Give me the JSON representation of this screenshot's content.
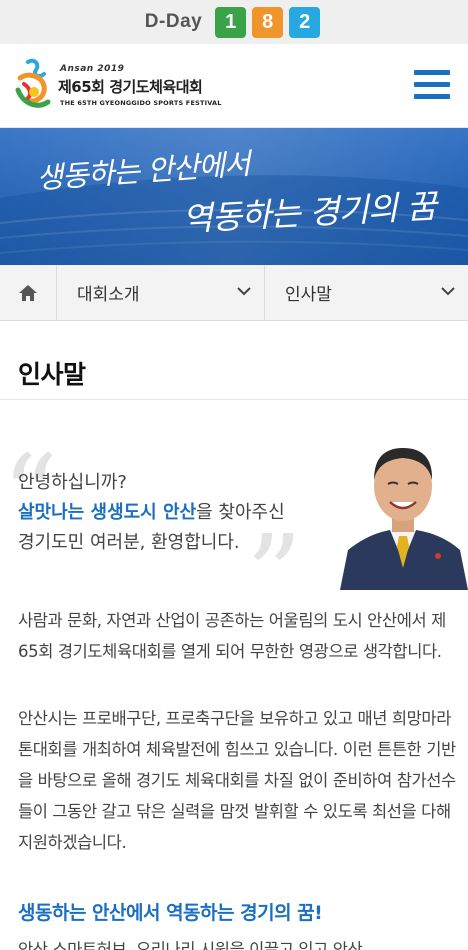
{
  "dday": {
    "label": "D-Day",
    "digits": [
      {
        "value": "1",
        "color": "#3aa347"
      },
      {
        "value": "8",
        "color": "#f0952c"
      },
      {
        "value": "2",
        "color": "#27a8e0"
      }
    ]
  },
  "header": {
    "logo_sub": "Ansan 2019",
    "logo_title": "제65회 경기도체육대회",
    "logo_en": "THE 65TH GYEONGGIDO SPORTS FESTIVAL",
    "menu_icon": "hamburger-icon",
    "accent_color": "#1a6fc1"
  },
  "banner": {
    "line1": "생동하는 안산에서",
    "line2": "역동하는 경기의 꿈"
  },
  "breadcrumb": {
    "home_icon": "home-icon",
    "level1": "대회소개",
    "level2": "인사말"
  },
  "page": {
    "title": "인사말",
    "greeting_line1": "안녕하십니까?",
    "greeting_hl": "살맛나는 생생도시 안산",
    "greeting_line2_rest": "을 찾아주신",
    "greeting_line3": "경기도민 여러분, 환영합니다.",
    "para1": "사람과 문화, 자연과 산업이 공존하는 어울림의 도시 안산에서 제65회 경기도체육대회를 열게 되어 무한한 영광으로 생각합니다.",
    "para2": "안산시는 프로배구단, 프로축구단을 보유하고 있고 매년 희망마라톤대회를 개최하여 체육발전에 힘쓰고 있습니다. 이런 튼튼한 기반을 바탕으로 올해 경기도 체육대회를 차질 없이 준비하여 참가선수들이 그동안 갈고 닦은 실력을 맘껏 발휘할 수 있도록 최선을 다해 지원하겠습니다.",
    "subheading": "생동하는 안산에서 역동하는 경기의 꿈!",
    "para3": "안산 스마트허브, 오리나리 시원을 이끌고 있고 안산"
  }
}
